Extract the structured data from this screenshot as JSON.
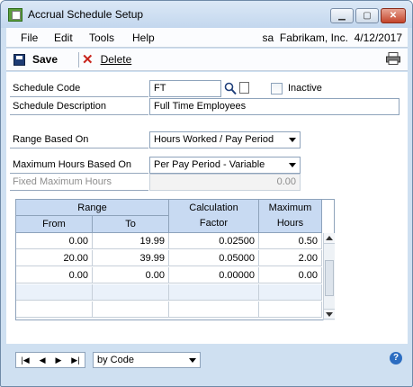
{
  "window": {
    "title": "Accrual Schedule Setup"
  },
  "menu": {
    "items": [
      "File",
      "Edit",
      "Tools",
      "Help"
    ],
    "user": "sa",
    "company": "Fabrikam, Inc.",
    "date": "4/12/2017"
  },
  "toolbar": {
    "save_label": "Save",
    "delete_label": "Delete"
  },
  "form": {
    "schedule_code_label": "Schedule Code",
    "schedule_code_value": "FT",
    "inactive_label": "Inactive",
    "inactive_checked": false,
    "schedule_description_label": "Schedule Description",
    "schedule_description_value": "Full Time Employees",
    "range_based_on_label": "Range Based On",
    "range_based_on_value": "Hours Worked / Pay Period",
    "max_hours_based_on_label": "Maximum Hours Based On",
    "max_hours_based_on_value": "Per Pay Period - Variable",
    "fixed_max_hours_label": "Fixed Maximum Hours",
    "fixed_max_hours_value": "0.00"
  },
  "grid": {
    "header_range": "Range",
    "header_calculation": "Calculation",
    "header_maximum": "Maximum",
    "header_from": "From",
    "header_to": "To",
    "header_factor": "Factor",
    "header_hours": "Hours",
    "rows": [
      [
        "0.00",
        "19.99",
        "0.02500",
        "0.50"
      ],
      [
        "20.00",
        "39.99",
        "0.05000",
        "2.00"
      ],
      [
        "0.00",
        "0.00",
        "0.00000",
        "0.00"
      ],
      [
        "",
        "",
        "",
        ""
      ],
      [
        "",
        "",
        "",
        ""
      ]
    ]
  },
  "footer": {
    "sort_value": "by Code",
    "help": "?"
  },
  "icons": [
    "app-icon",
    "save-icon",
    "delete-icon",
    "print-icon",
    "lookup-icon",
    "note-icon",
    "help-icon"
  ]
}
